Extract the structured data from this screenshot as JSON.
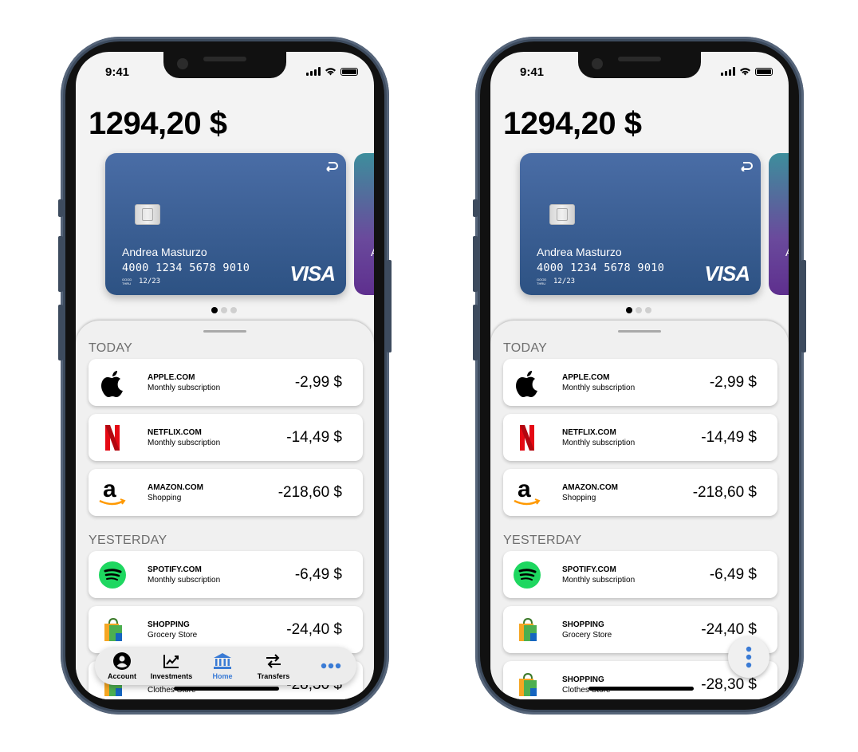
{
  "status": {
    "time": "9:41"
  },
  "balance": "1294,20 $",
  "card": {
    "holder": "Andrea Masturzo",
    "number": "4000 1234 5678 9010",
    "good_thru": "GOOD THRU",
    "expiry": "12/23",
    "brand": "VISA",
    "next_card_holder_initial": "A"
  },
  "pager": {
    "count": 3,
    "active": 0
  },
  "sections": {
    "today": "TODAY",
    "yesterday": "YESTERDAY"
  },
  "transactions_today": [
    {
      "merchant": "APPLE.COM",
      "description": "Monthly subscription",
      "amount": "-2,99 $",
      "icon": "apple-logo-icon"
    },
    {
      "merchant": "NETFLIX.COM",
      "description": "Monthly subscription",
      "amount": "-14,49 $",
      "icon": "netflix-logo-icon"
    },
    {
      "merchant": "AMAZON.COM",
      "description": "Shopping",
      "amount": "-218,60 $",
      "icon": "amazon-logo-icon"
    }
  ],
  "transactions_yesterday": [
    {
      "merchant": "SPOTIFY.COM",
      "description": "Monthly subscription",
      "amount": "-6,49 $",
      "icon": "spotify-logo-icon"
    },
    {
      "merchant": "SHOPPING",
      "description": "Grocery Store",
      "amount": "-24,40 $",
      "icon": "shopping-bag-icon"
    },
    {
      "merchant": "SHOPPING",
      "description": "Clothes Store",
      "amount": "-28,30 $",
      "icon": "shopping-bag-icon"
    }
  ],
  "tabbar": {
    "account": "Account",
    "investments": "Investments",
    "home": "Home",
    "transfers": "Transfers"
  },
  "colors": {
    "card_top": "#4a6da6",
    "card_bottom": "#2d5283",
    "active_tab": "#3a7bd5",
    "frame": "#3d4b5e",
    "netflix_red": "#e50914",
    "spotify_green": "#1ed760",
    "amazon_orange": "#ff9900"
  }
}
